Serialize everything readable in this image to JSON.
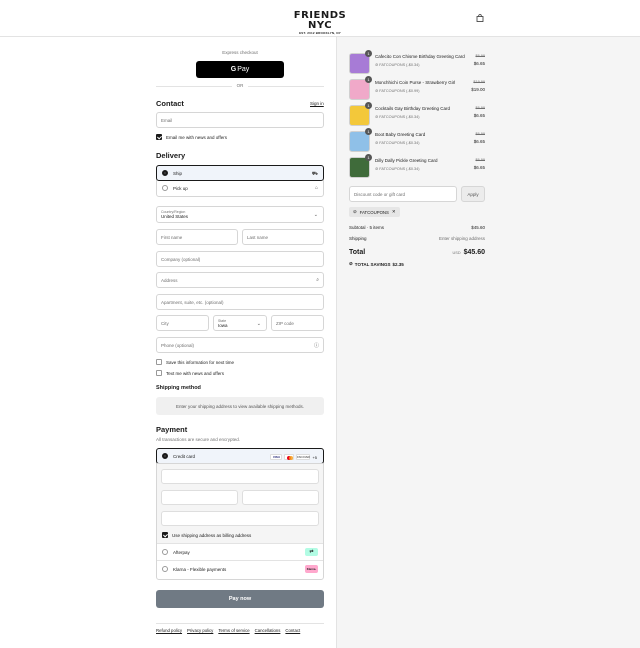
{
  "header": {
    "logo_main": "FRIENDS NYC",
    "logo_sub": "EST. 2012 BROOKLYN, NY"
  },
  "express": {
    "label": "Express checkout",
    "gpay_label": "Pay",
    "or": "OR"
  },
  "contact": {
    "title": "Contact",
    "sign_in": "Sign in",
    "email_placeholder": "Email",
    "email_news_label": "Email me with news and offers",
    "email_news_checked": true
  },
  "delivery": {
    "title": "Delivery",
    "options": [
      {
        "label": "Ship",
        "selected": true,
        "icon": "truck-icon"
      },
      {
        "label": "Pick up",
        "selected": false,
        "icon": "store-icon"
      }
    ],
    "country_label": "Country/Region",
    "country_value": "United States",
    "first_name": "First name",
    "last_name": "Last name",
    "company": "Company (optional)",
    "address": "Address",
    "apartment": "Apartment, suite, etc. (optional)",
    "city": "City",
    "state_label": "State",
    "state_value": "Iowa",
    "zip": "ZIP code",
    "phone": "Phone (optional)",
    "save_info_label": "Save this information for next time",
    "text_news_label": "Text me with news and offers"
  },
  "shipping_method": {
    "title": "Shipping method",
    "info": "Enter your shipping address to view available shipping methods."
  },
  "payment": {
    "title": "Payment",
    "subtitle": "All transactions are secure and encrypted.",
    "credit_card_label": "Credit card",
    "card_logos": [
      "VISA",
      "mastercard",
      "DISCOVER"
    ],
    "more_cards": "+5",
    "billing_label": "Use shipping address as billing address",
    "afterpay_label": "Afterpay",
    "klarna_label": "Klarna - Flexible payments",
    "klarna_badge": "Klarna.",
    "pay_now": "Pay now"
  },
  "footer": {
    "links": [
      "Refund policy",
      "Privacy policy",
      "Terms of service",
      "Cancellations",
      "Contact"
    ]
  },
  "order": {
    "items": [
      {
        "name": "Cafecito Con Chisme Birthday Greeting Card",
        "discount": "FATCOUPONS (-$0.34)",
        "original": "$6.99",
        "price": "$6.65",
        "qty": "1",
        "color": "#a77bd6"
      },
      {
        "name": "Monchhichi Coin Purse - Strawberry Girl",
        "discount": "FATCOUPONS (-$0.99)",
        "original": "$19.99",
        "price": "$19.00",
        "qty": "1",
        "color": "#f0a9c9"
      },
      {
        "name": "Cocktails Gay Birthday Greeting Card",
        "discount": "FATCOUPONS (-$0.34)",
        "original": "$6.99",
        "price": "$6.65",
        "qty": "1",
        "color": "#f3c83a"
      },
      {
        "name": "Boot Baby Greeting Card",
        "discount": "FATCOUPONS (-$0.34)",
        "original": "$6.99",
        "price": "$6.65",
        "qty": "1",
        "color": "#8fc0e8"
      },
      {
        "name": "Dilly Dally Pickle Greeting Card",
        "discount": "FATCOUPONS (-$0.34)",
        "original": "$6.99",
        "price": "$6.65",
        "qty": "1",
        "color": "#3f6b3a"
      }
    ],
    "code_placeholder": "Discount code or gift card",
    "apply": "Apply",
    "coupon": "FATCOUPONS",
    "subtotal_label": "Subtotal · 5 items",
    "subtotal_value": "$45.60",
    "shipping_label": "Shipping",
    "shipping_value": "Enter shipping address",
    "total_label": "Total",
    "currency": "USD",
    "total_value": "$45.60",
    "savings_label": "TOTAL SAVINGS",
    "savings_value": "$2.35"
  }
}
